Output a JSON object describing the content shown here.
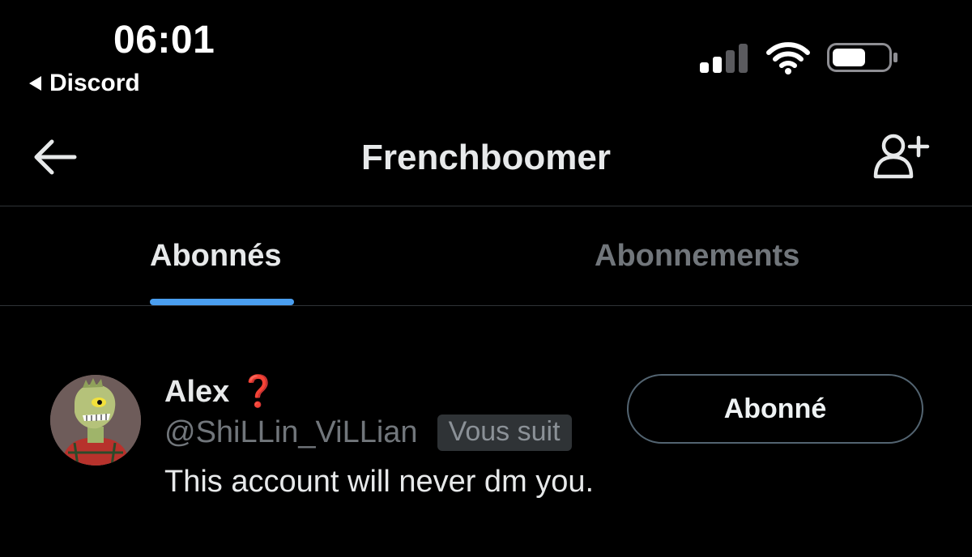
{
  "status_bar": {
    "time": "06:01",
    "back_app_label": "Discord",
    "signal_bars_active": 2,
    "signal_bars_total": 4,
    "battery_level": 0.6
  },
  "header": {
    "title": "Frenchboomer",
    "back_icon": "arrow-left-icon",
    "action_icon": "person-add-icon"
  },
  "tabs": [
    {
      "label": "Abonnés",
      "active": true
    },
    {
      "label": "Abonnements",
      "active": false
    }
  ],
  "colors": {
    "background": "#000000",
    "text_primary": "#e7e9ea",
    "text_secondary": "#71767b",
    "accent": "#4a9eef",
    "divider": "#2f3336"
  },
  "users": [
    {
      "name": "Alex",
      "name_emoji": "❓",
      "handle": "@ShiLLin_ViLLian",
      "follows_you_badge": "Vous suit",
      "bio": "This account will never dm you.",
      "follow_button_label": "Abonné",
      "avatar_icon": "lizard-avatar"
    }
  ]
}
